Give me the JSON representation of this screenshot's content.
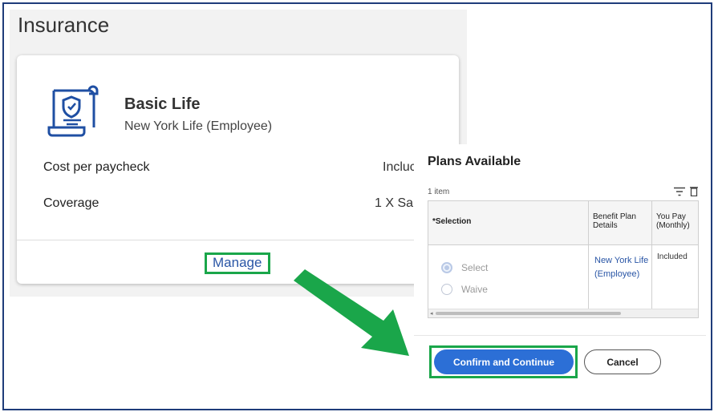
{
  "insurance": {
    "title": "Insurance",
    "card": {
      "icon": "shield-scroll-icon",
      "plan_name": "Basic Life",
      "provider": "New York Life (Employee)",
      "rows": [
        {
          "label": "Cost per paycheck",
          "value": "Incluc"
        },
        {
          "label": "Coverage",
          "value": "1 X Sal"
        }
      ],
      "manage_label": "Manage"
    }
  },
  "plans": {
    "title": "Plans Available",
    "item_count": "1 item",
    "columns": {
      "selection": "*Selection",
      "details": "Benefit Plan Details",
      "pay": "You Pay (Monthly)"
    },
    "row": {
      "options": [
        {
          "label": "Select",
          "checked": true
        },
        {
          "label": "Waive",
          "checked": false
        }
      ],
      "details_link": "New York Life (Employee)",
      "pay": "Included"
    },
    "confirm_label": "Confirm and Continue",
    "cancel_label": "Cancel"
  },
  "colors": {
    "highlight": "#1aa64a",
    "primary_button": "#2c6fd6",
    "link": "#2a56a6",
    "frame": "#1f3c7a"
  }
}
